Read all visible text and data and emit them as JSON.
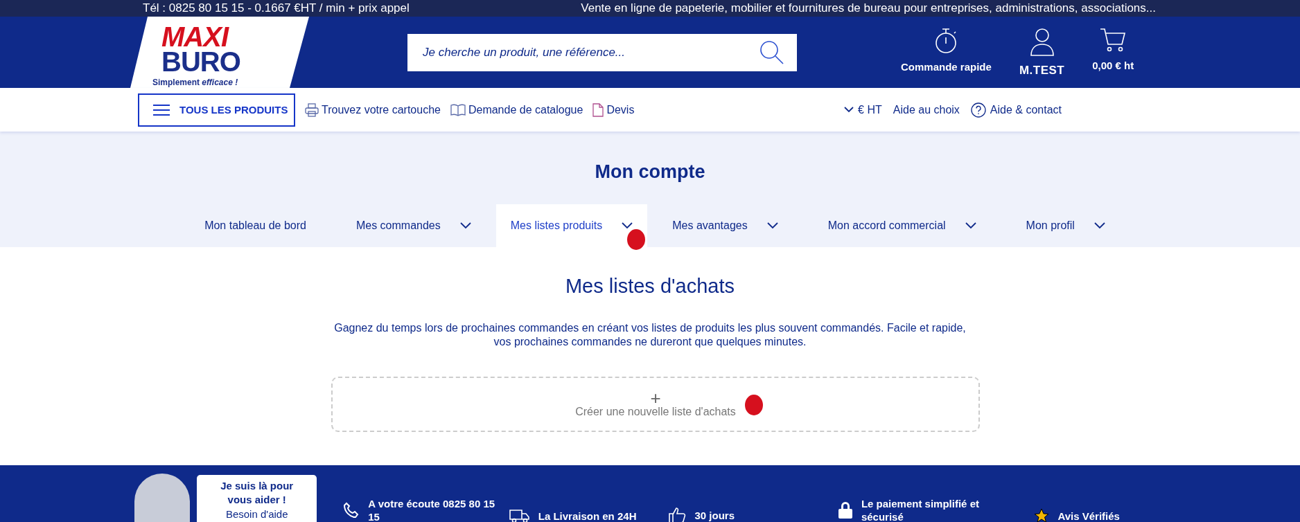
{
  "top_bar": {
    "phone": "Tél : 0825 80 15 15 - 0.1667 €HT / min + prix appel",
    "tagline": "Vente en ligne de papeterie, mobilier et fournitures de bureau pour entreprises, administrations, associations..."
  },
  "header": {
    "logo": {
      "line_1": "MAXI",
      "line_2": "BURO",
      "slogan": "Simplement *efficace !*"
    },
    "search": {
      "placeholder": "Je cherche un produit, une référence..."
    },
    "actions": [
      {
        "kind": "timer",
        "label": "Commande rapide"
      },
      {
        "kind": "user",
        "label": "M.TEST"
      },
      {
        "kind": "cart",
        "label": "0,00 € ht"
      }
    ]
  },
  "nav": {
    "menu_button": "TOUS LES PRODUITS",
    "links": [
      {
        "kind": "printer",
        "label": "Trouvez votre cartouche"
      },
      {
        "kind": "book",
        "label": "Demande de catalogue"
      },
      {
        "kind": "document",
        "label": "Devis"
      }
    ],
    "right_links": [
      {
        "kind": "caret",
        "label": "€ HT"
      },
      {
        "kind": "plain",
        "label": "Aide au choix"
      },
      {
        "kind": "help",
        "label": "Aide & contact"
      }
    ]
  },
  "account": {
    "title": "Mon compte",
    "tabs": [
      {
        "label": "Mon tableau de bord",
        "dropdown": false,
        "selected": false
      },
      {
        "label": "Mes commandes",
        "dropdown": true,
        "selected": false
      },
      {
        "label": "Mes listes produits",
        "dropdown": true,
        "selected": true
      },
      {
        "label": "Mes avantages",
        "dropdown": true,
        "selected": false
      },
      {
        "label": "Mon accord commercial",
        "dropdown": true,
        "selected": false
      },
      {
        "label": "Mon profil",
        "dropdown": true,
        "selected": false
      }
    ]
  },
  "lists": {
    "title": "Mes listes d'achats",
    "description": "Gagnez du temps lors de prochaines commandes en créant vos listes de produits les plus souvent commandés. Facile et rapide, vos prochaines commandes ne dureront que quelques minutes.",
    "create_button": {
      "icon": "+",
      "label": "Créer une nouvelle liste d'achats"
    }
  },
  "footer": {
    "help_card": {
      "title": "Je suis là pour vous aider !",
      "link": "Besoin d'aide"
    },
    "features": [
      {
        "kind": "phone",
        "text": "A votre écoute 0825 80 15 15"
      },
      {
        "kind": "truck",
        "text": "La Livraison en 24H"
      },
      {
        "kind": "thumb",
        "text": "30 jours"
      },
      {
        "kind": "lock",
        "text": "Le paiement simplifié et sécurisé"
      },
      {
        "kind": "star",
        "text": "Avis Vérifiés"
      }
    ]
  }
}
